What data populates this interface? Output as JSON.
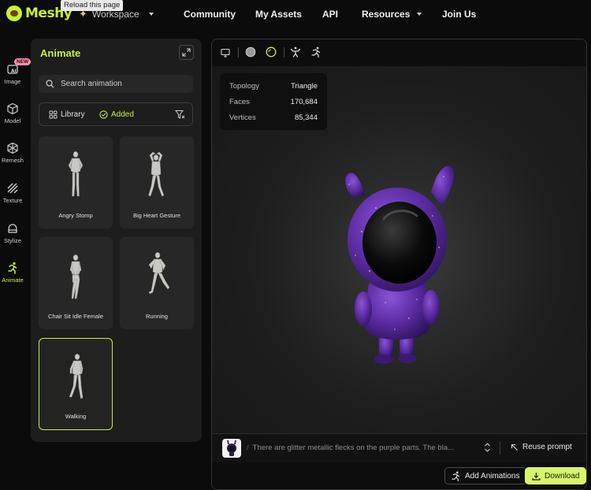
{
  "brand": {
    "name": "Meshy"
  },
  "tooltip": "Reload this page",
  "nav": {
    "workspace": "Workspace",
    "items": [
      "Community",
      "My Assets",
      "API",
      "Resources",
      "Join Us"
    ]
  },
  "rail": {
    "badge": "NEW",
    "items": [
      {
        "label": "Image",
        "icon": "image-ai-icon"
      },
      {
        "label": "Model",
        "icon": "cube-icon"
      },
      {
        "label": "Remesh",
        "icon": "remesh-icon"
      },
      {
        "label": "Texture",
        "icon": "texture-icon"
      },
      {
        "label": "Stylize",
        "icon": "stylize-icon"
      },
      {
        "label": "Animate",
        "icon": "running-figure-icon",
        "active": true
      }
    ]
  },
  "panel": {
    "title": "Animate",
    "search_placeholder": "Search animation",
    "filters": {
      "library": "Library",
      "added": "Added"
    },
    "animations": [
      {
        "label": "Angry Stomp"
      },
      {
        "label": "Big Heart Gesture"
      },
      {
        "label": "Chair Sit Idle Female"
      },
      {
        "label": "Running"
      },
      {
        "label": "Walking",
        "selected": true
      }
    ]
  },
  "viewer": {
    "stats": [
      {
        "key": "Topology",
        "value": "Triangle"
      },
      {
        "key": "Faces",
        "value": "170,684"
      },
      {
        "key": "Vertices",
        "value": "85,344"
      }
    ],
    "prompt": "There are glitter metallic flecks on the purple parts. The bla...",
    "reuse_prompt": "Reuse prompt",
    "add_animations": "Add Animations",
    "download": "Download"
  },
  "colors": {
    "accent": "#c6f135",
    "badge": "#ff8fa8",
    "download": "#d6f56b",
    "model_purple": "#5a2aa0"
  }
}
